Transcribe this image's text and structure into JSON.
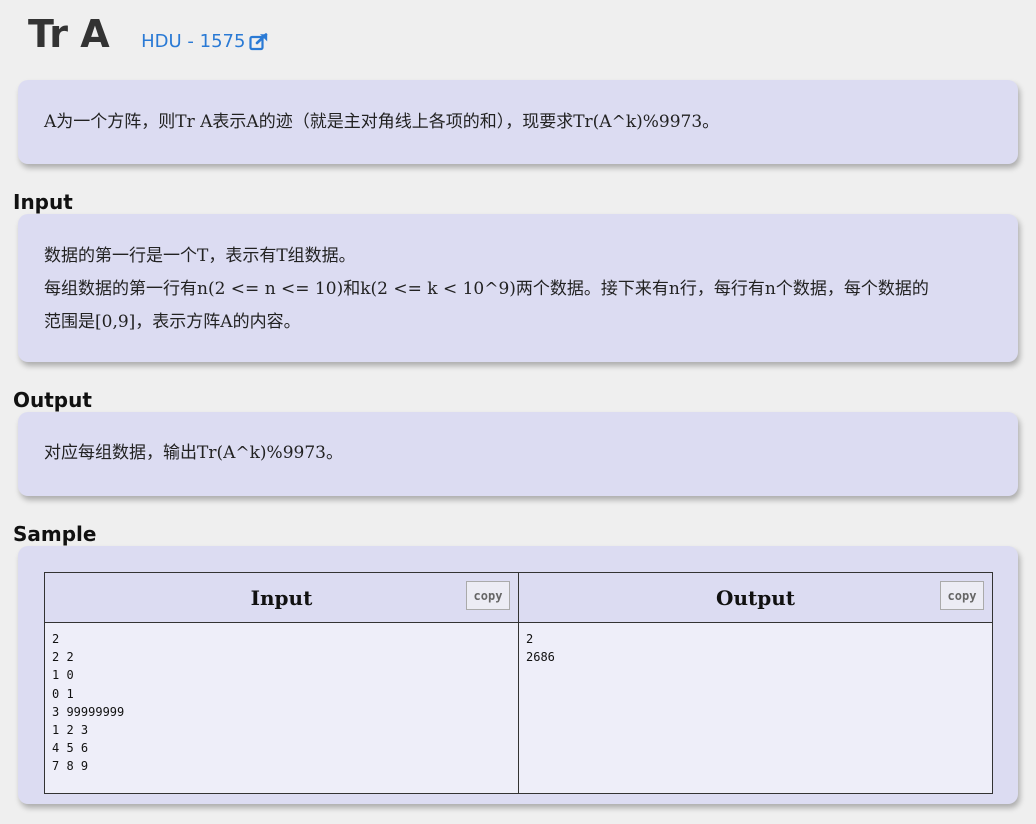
{
  "header": {
    "title": "Tr A",
    "source_link": "HDU - 1575",
    "link_icon": "external-link-icon"
  },
  "description": {
    "text": "A为一个方阵，则Tr A表示A的迹（就是主对角线上各项的和），现要求Tr(A^k)%9973。"
  },
  "input": {
    "heading": "Input",
    "lines": [
      "数据的第一行是一个T，表示有T组数据。",
      "每组数据的第一行有n(2 <= n <= 10)和k(2 <= k < 10^9)两个数据。接下来有n行，每行有n个数据，每个数据的",
      "范围是[0,9]，表示方阵A的内容。"
    ]
  },
  "output": {
    "heading": "Output",
    "text": "对应每组数据，输出Tr(A^k)%9973。"
  },
  "sample": {
    "heading": "Sample",
    "input_header": "Input",
    "output_header": "Output",
    "copy_label": "copy",
    "input_text": "2\n2 2\n1 0\n0 1\n3 99999999\n1 2 3\n4 5 6\n7 8 9",
    "output_text": "2\n2686"
  },
  "colors": {
    "background": "#efefef",
    "card": "#dcdcf2",
    "link": "#2a7ad5"
  }
}
